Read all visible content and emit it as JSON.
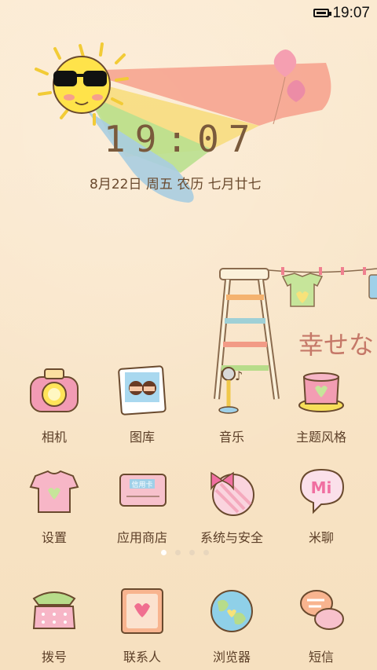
{
  "status_bar": {
    "time": "19:07"
  },
  "widget": {
    "clock": "19:07",
    "date": "8月22日 周五 农历 七月廿七"
  },
  "wallpaper": {
    "sign_text": "幸せな"
  },
  "apps": [
    {
      "label": "相机",
      "icon": "camera-icon"
    },
    {
      "label": "图库",
      "icon": "gallery-icon"
    },
    {
      "label": "音乐",
      "icon": "music-icon"
    },
    {
      "label": "主题风格",
      "icon": "theme-icon"
    },
    {
      "label": "设置",
      "icon": "settings-icon"
    },
    {
      "label": "应用商店",
      "icon": "app-store-icon"
    },
    {
      "label": "系统与安全",
      "icon": "security-icon"
    },
    {
      "label": "米聊",
      "icon": "miliao-icon"
    }
  ],
  "gallery_card_text": "信用卡",
  "miliao_badge": "Mi",
  "dock": [
    {
      "label": "拨号",
      "icon": "phone-icon"
    },
    {
      "label": "联系人",
      "icon": "contacts-icon"
    },
    {
      "label": "浏览器",
      "icon": "browser-icon"
    },
    {
      "label": "短信",
      "icon": "messages-icon"
    }
  ],
  "pages": {
    "count": 4,
    "active": 0
  }
}
